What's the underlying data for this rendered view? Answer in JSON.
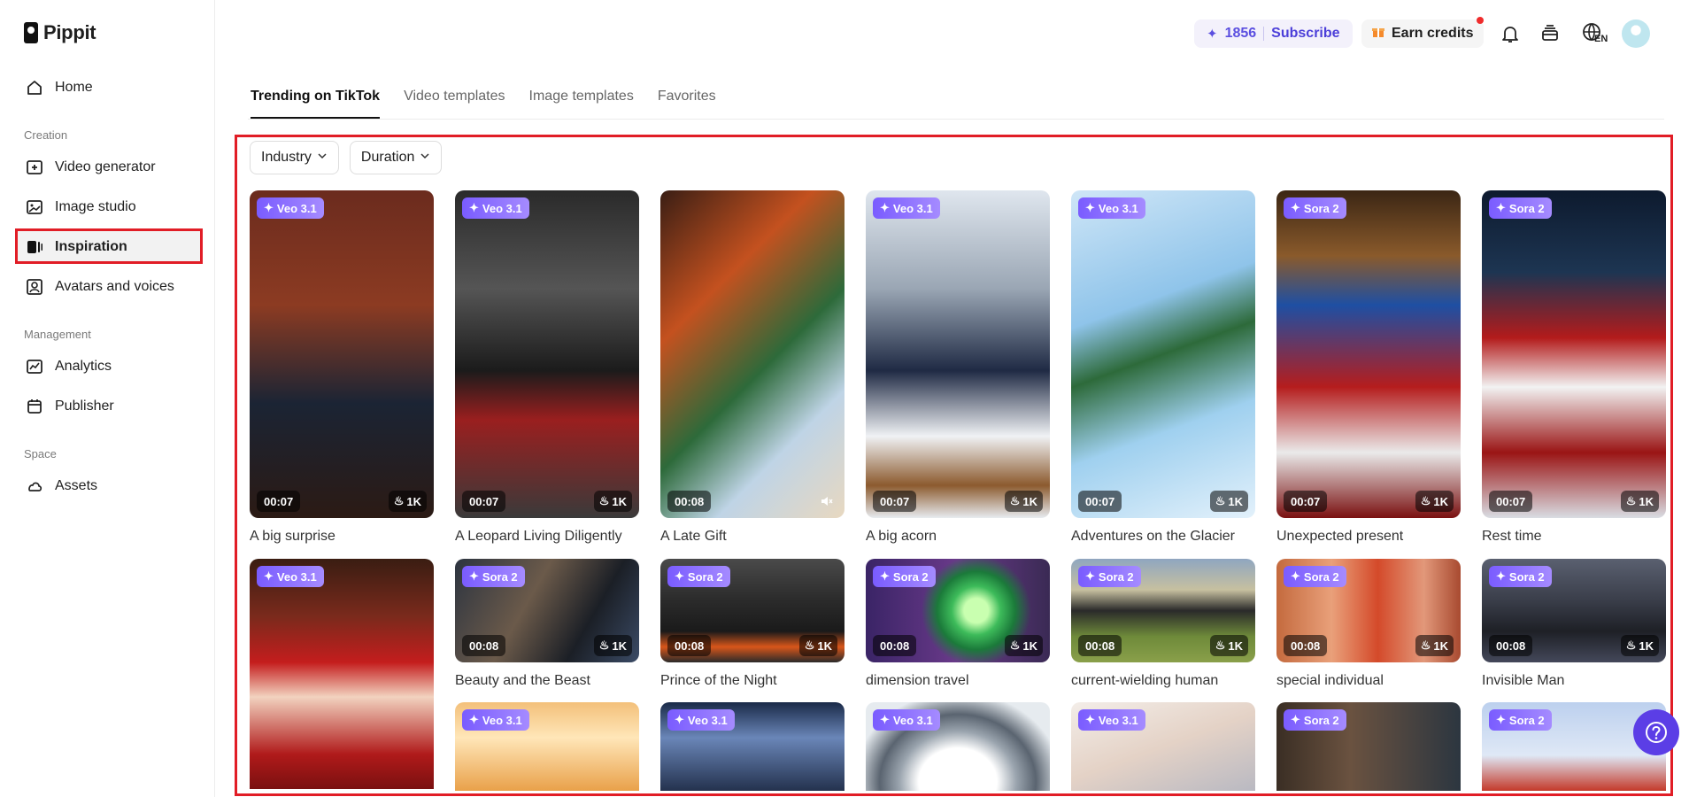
{
  "brand": {
    "name": "Pippit"
  },
  "sidebar": {
    "home": "Home",
    "sections": [
      {
        "label": "Creation",
        "items": [
          "Video generator",
          "Image studio",
          "Inspiration",
          "Avatars and voices"
        ]
      },
      {
        "label": "Management",
        "items": [
          "Analytics",
          "Publisher"
        ]
      },
      {
        "label": "Space",
        "items": [
          "Assets"
        ]
      }
    ],
    "active_item": "Inspiration"
  },
  "topbar": {
    "credits": "1856",
    "subscribe": "Subscribe",
    "earn_credits": "Earn credits",
    "language": "EN"
  },
  "tabs": [
    "Trending on TikTok",
    "Video templates",
    "Image templates",
    "Favorites"
  ],
  "active_tab": "Trending on TikTok",
  "filters": [
    "Industry",
    "Duration"
  ],
  "cards_row1": [
    {
      "title": "A big surprise",
      "model": "Veo 3.1",
      "duration": "00:07",
      "likes": "1K"
    },
    {
      "title": "A Leopard Living Diligently",
      "model": "Veo 3.1",
      "duration": "00:07",
      "likes": "1K"
    },
    {
      "title": "A Late Gift",
      "model": "",
      "duration": "00:08",
      "likes": ""
    },
    {
      "title": "A big acorn",
      "model": "Veo 3.1",
      "duration": "00:07",
      "likes": "1K"
    },
    {
      "title": "Adventures on the Glacier",
      "model": "Veo 3.1",
      "duration": "00:07",
      "likes": "1K"
    },
    {
      "title": "Unexpected present",
      "model": "Sora 2",
      "duration": "00:07",
      "likes": "1K"
    },
    {
      "title": "Rest time",
      "model": "Sora 2",
      "duration": "00:07",
      "likes": "1K"
    }
  ],
  "cards_row2": [
    {
      "title": "",
      "model": "Veo 3.1",
      "duration": "",
      "likes": ""
    },
    {
      "title": "Beauty and the Beast",
      "model": "Sora 2",
      "duration": "00:08",
      "likes": "1K"
    },
    {
      "title": "Prince of the Night",
      "model": "Sora 2",
      "duration": "00:08",
      "likes": "1K"
    },
    {
      "title": "dimension travel",
      "model": "Sora 2",
      "duration": "00:08",
      "likes": "1K"
    },
    {
      "title": "current-wielding human",
      "model": "Sora 2",
      "duration": "00:08",
      "likes": "1K"
    },
    {
      "title": "special individual",
      "model": "Sora 2",
      "duration": "00:08",
      "likes": "1K"
    },
    {
      "title": "Invisible Man",
      "model": "Sora 2",
      "duration": "00:08",
      "likes": "1K"
    }
  ],
  "cards_row3": [
    {
      "model": "Veo 3.1"
    },
    {
      "model": "Veo 3.1"
    },
    {
      "model": "Veo 3.1"
    },
    {
      "model": "Veo 3.1"
    },
    {
      "model": "Sora 2"
    },
    {
      "model": "Sora 2"
    }
  ],
  "colors": {
    "accent": "#5b3ee6",
    "highlight_border": "#e11d26",
    "badge": "#7a5cff"
  }
}
